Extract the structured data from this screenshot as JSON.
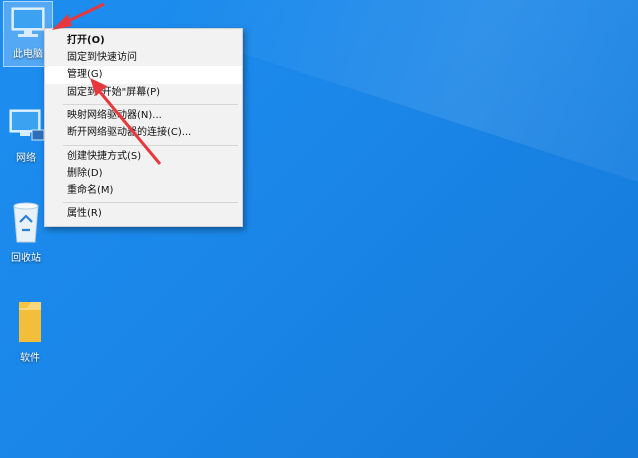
{
  "desktop": {
    "icons": [
      {
        "label": "此电脑",
        "icon": "this-pc-icon"
      },
      {
        "label": "网络",
        "icon": "network-icon"
      },
      {
        "label": "回收站",
        "icon": "recycle-bin-icon"
      },
      {
        "label": "软件",
        "icon": "folder-icon"
      }
    ]
  },
  "context_menu": {
    "items": [
      {
        "label": "打开(O)",
        "bold": true
      },
      {
        "label": "固定到快速访问"
      },
      {
        "label": "管理(G)",
        "highlighted": true
      },
      {
        "label": "固定到\"开始\"屏幕(P)"
      },
      {
        "label": "映射网络驱动器(N)..."
      },
      {
        "label": "断开网络驱动器的连接(C)..."
      },
      {
        "label": "创建快捷方式(S)"
      },
      {
        "label": "删除(D)"
      },
      {
        "label": "重命名(M)"
      },
      {
        "label": "属性(R)"
      }
    ]
  },
  "annotation": {
    "arrow_color": "#e8383d",
    "icon": "red-arrow-annotation"
  },
  "colors": {
    "desktop_bg": "#1a86e8",
    "menu_bg": "#f2f2f2"
  }
}
